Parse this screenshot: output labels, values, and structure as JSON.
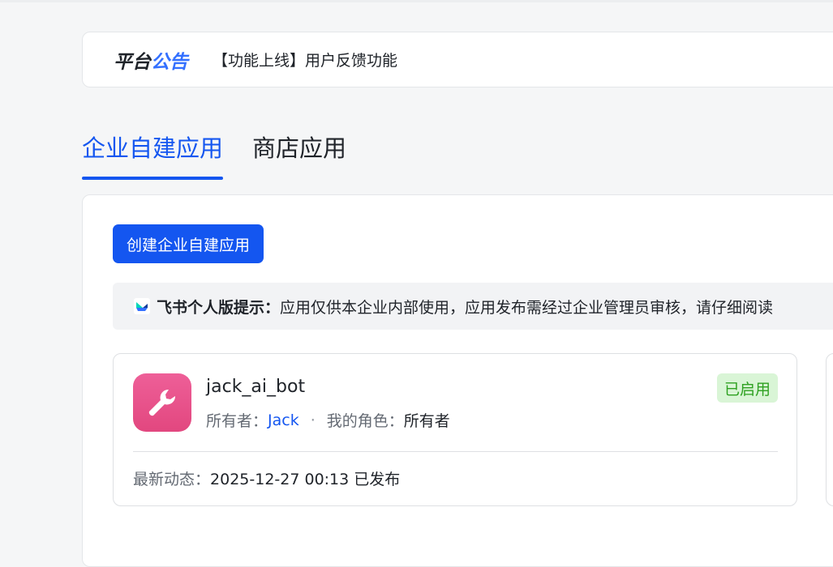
{
  "announcement": {
    "title_part1": "平台",
    "title_part2": "公告",
    "text": "【功能上线】用户反馈功能"
  },
  "tabs": [
    {
      "label": "企业自建应用",
      "active": true
    },
    {
      "label": "商店应用",
      "active": false
    }
  ],
  "create_button": "创建企业自建应用",
  "tip": {
    "label": "飞书个人版提示：",
    "text": "应用仅供本企业内部使用，应用发布需经过企业管理员审核，请仔细阅读"
  },
  "app_card": {
    "name": "jack_ai_bot",
    "owner_label": "所有者：",
    "owner": "Jack",
    "separator": "·",
    "role_label": "我的角色：",
    "role": "所有者",
    "status": "已启用",
    "activity_label": "最新动态：",
    "activity_value": "2025-12-27 00:13 已发布",
    "icon": "wrench-icon"
  },
  "colors": {
    "accent": "#1456f0",
    "status_bg": "#d9f5d6",
    "status_text": "#2ea121",
    "app_icon": "#e8548b"
  }
}
